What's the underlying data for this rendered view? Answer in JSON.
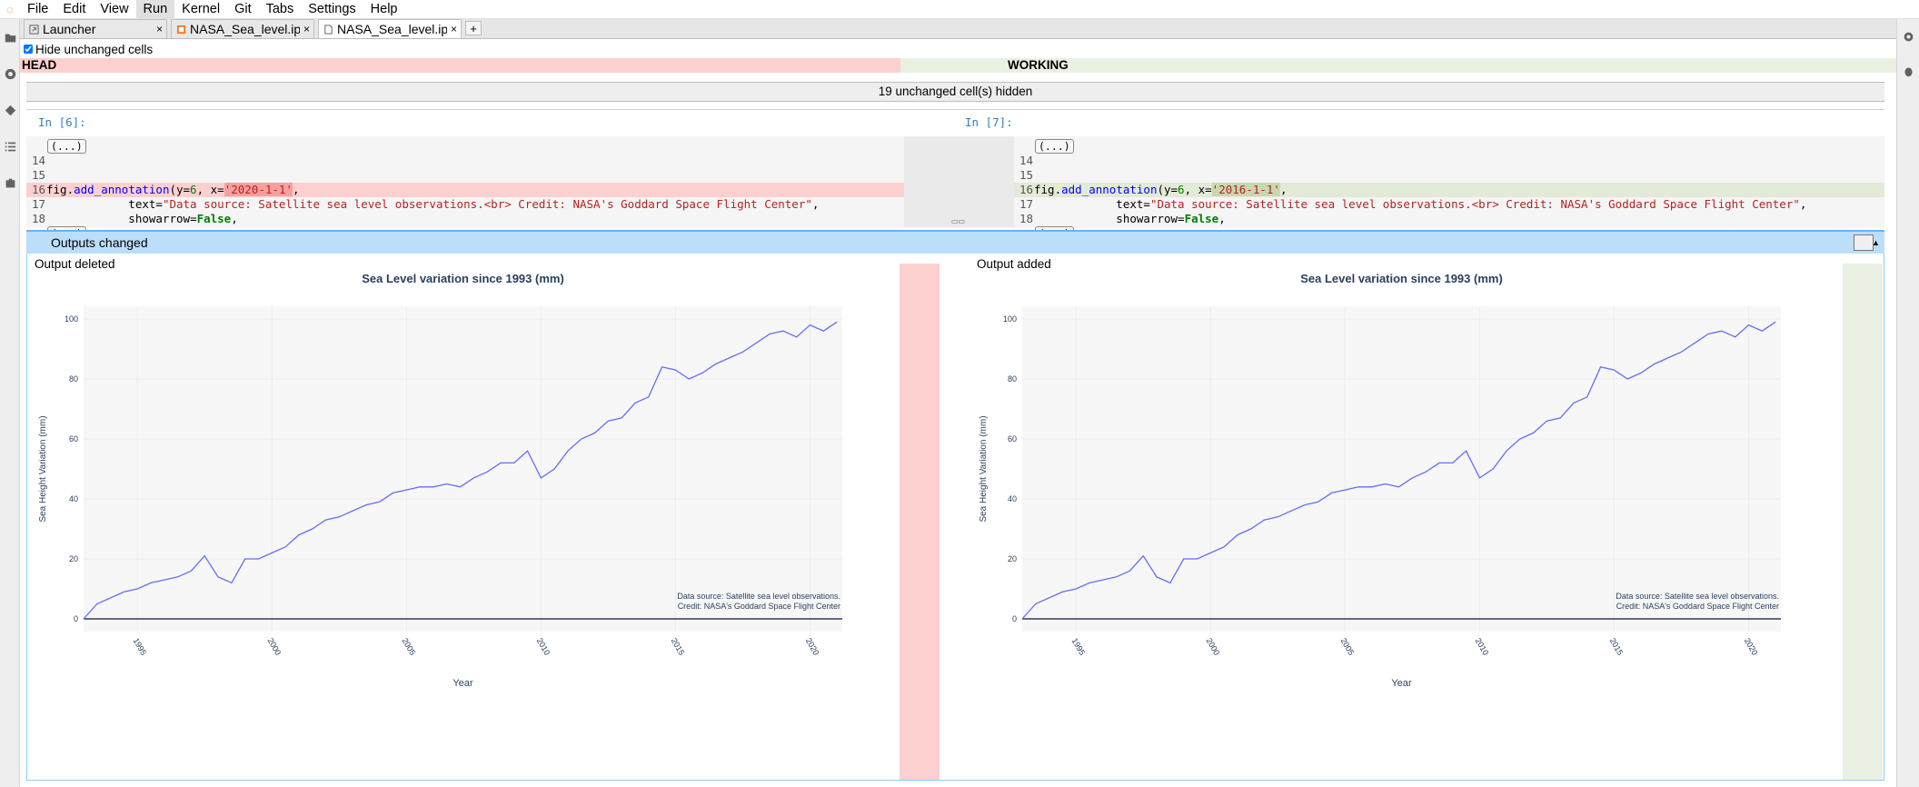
{
  "menubar": {
    "items": [
      "File",
      "Edit",
      "View",
      "Run",
      "Kernel",
      "Git",
      "Tabs",
      "Settings",
      "Help"
    ],
    "active": "Run"
  },
  "tabs": [
    {
      "label": "Launcher",
      "icon": "launcher-icon",
      "close": "×"
    },
    {
      "label": "NASA_Sea_level.ipynb",
      "icon": "notebook-icon",
      "close": "×"
    },
    {
      "label": "NASA_Sea_level.ipynb",
      "icon": "diff-file-icon",
      "close": "×"
    }
  ],
  "add_tab": "+",
  "diff": {
    "hide_unchanged_label": "Hide unchanged cells",
    "hide_unchanged_checked": true,
    "head_label": "HEAD",
    "working_label": "WORKING",
    "hidden_cells_text": "19 unchanged cell(s) hidden",
    "left_prompt": "In [6]:",
    "right_prompt": "In [7]:",
    "ellipsis": "(...)",
    "line_numbers": [
      "14",
      "15",
      "16",
      "17",
      "18"
    ],
    "left_code": {
      "l16_pre": "fig.",
      "l16_fn": "add_annotation",
      "l16_mid": "(y=",
      "l16_num": "6",
      "l16_mid2": ", x=",
      "l16_str": "'2020-1-1'",
      "l16_end": ",",
      "l17_indent": "            text=",
      "l17_str": "\"Data source: Satellite sea level observations.<br> Credit: NASA's Goddard Space Flight Center\"",
      "l17_end": ",",
      "l18_indent": "            showarrow=",
      "l18_kw": "False",
      "l18_end": ","
    },
    "right_code": {
      "l16_pre": "fig.",
      "l16_fn": "add_annotation",
      "l16_mid": "(y=",
      "l16_num": "6",
      "l16_mid2": ", x=",
      "l16_str": "'2016-1-1'",
      "l16_end": ",",
      "l17_indent": "            text=",
      "l17_str": "\"Data source: Satellite sea level observations.<br> Credit: NASA's Goddard Space Flight Center\"",
      "l17_end": ",",
      "l18_indent": "            showarrow=",
      "l18_kw": "False",
      "l18_end": ","
    },
    "outputs_changed_label": "Outputs changed",
    "output_deleted_label": "Output deleted",
    "output_added_label": "Output added"
  },
  "colors": {
    "deleted": "#fdd0d0",
    "added": "#eaf0e2",
    "line": "#636efa",
    "plot_bg": "#f7f7f7"
  },
  "chart_data": [
    {
      "type": "line",
      "title": "Sea Level variation since 1993 (mm)",
      "xlabel": "Year",
      "ylabel": "Sea Height Variation (mm)",
      "xticks": [
        "1995",
        "2000",
        "2005",
        "2010",
        "2015",
        "2020"
      ],
      "yticks": [
        0,
        20,
        40,
        60,
        80,
        100
      ],
      "ylim": [
        0,
        100
      ],
      "xlim": [
        1993.0,
        2021.2
      ],
      "annotation": {
        "lines": [
          "Data source: Satellite sea level observations.",
          "Credit: NASA's Goddard Space Flight Center"
        ],
        "x": "2020-1-1",
        "y": 6
      },
      "series": [
        {
          "x": [
            1993.0,
            1993.5,
            1994.0,
            1994.5,
            1995.0,
            1995.5,
            1996.0,
            1996.5,
            1997.0,
            1997.5,
            1998.0,
            1998.5,
            1999.0,
            1999.5,
            2000.0,
            2000.5,
            2001.0,
            2001.5,
            2002.0,
            2002.5,
            2003.0,
            2003.5,
            2004.0,
            2004.5,
            2005.0,
            2005.5,
            2006.0,
            2006.5,
            2007.0,
            2007.5,
            2008.0,
            2008.5,
            2009.0,
            2009.5,
            2010.0,
            2010.5,
            2011.0,
            2011.5,
            2012.0,
            2012.5,
            2013.0,
            2013.5,
            2014.0,
            2014.5,
            2015.0,
            2015.5,
            2016.0,
            2016.5,
            2017.0,
            2017.5,
            2018.0,
            2018.5,
            2019.0,
            2019.5,
            2020.0,
            2020.5,
            2021.0
          ],
          "y": [
            0,
            5,
            7,
            9,
            10,
            12,
            13,
            14,
            16,
            21,
            14,
            12,
            20,
            20,
            22,
            24,
            28,
            30,
            33,
            34,
            36,
            38,
            39,
            42,
            43,
            44,
            44,
            45,
            44,
            47,
            49,
            52,
            52,
            56,
            47,
            50,
            56,
            60,
            62,
            66,
            67,
            72,
            74,
            84,
            83,
            80,
            82,
            85,
            87,
            89,
            92,
            95,
            96,
            94,
            98,
            96,
            99
          ]
        }
      ]
    },
    {
      "type": "line",
      "title": "Sea Level variation since 1993 (mm)",
      "xlabel": "Year",
      "ylabel": "Sea Height Variation (mm)",
      "xticks": [
        "1995",
        "2000",
        "2005",
        "2010",
        "2015",
        "2020"
      ],
      "yticks": [
        0,
        20,
        40,
        60,
        80,
        100
      ],
      "ylim": [
        0,
        100
      ],
      "xlim": [
        1993.0,
        2021.2
      ],
      "annotation": {
        "lines": [
          "Data source: Satellite sea level observations.",
          "Credit: NASA's Goddard Space Flight Center"
        ],
        "x": "2016-1-1",
        "y": 6
      },
      "series": [
        {
          "x": [
            1993.0,
            1993.5,
            1994.0,
            1994.5,
            1995.0,
            1995.5,
            1996.0,
            1996.5,
            1997.0,
            1997.5,
            1998.0,
            1998.5,
            1999.0,
            1999.5,
            2000.0,
            2000.5,
            2001.0,
            2001.5,
            2002.0,
            2002.5,
            2003.0,
            2003.5,
            2004.0,
            2004.5,
            2005.0,
            2005.5,
            2006.0,
            2006.5,
            2007.0,
            2007.5,
            2008.0,
            2008.5,
            2009.0,
            2009.5,
            2010.0,
            2010.5,
            2011.0,
            2011.5,
            2012.0,
            2012.5,
            2013.0,
            2013.5,
            2014.0,
            2014.5,
            2015.0,
            2015.5,
            2016.0,
            2016.5,
            2017.0,
            2017.5,
            2018.0,
            2018.5,
            2019.0,
            2019.5,
            2020.0,
            2020.5,
            2021.0
          ],
          "y": [
            0,
            5,
            7,
            9,
            10,
            12,
            13,
            14,
            16,
            21,
            14,
            12,
            20,
            20,
            22,
            24,
            28,
            30,
            33,
            34,
            36,
            38,
            39,
            42,
            43,
            44,
            44,
            45,
            44,
            47,
            49,
            52,
            52,
            56,
            47,
            50,
            56,
            60,
            62,
            66,
            67,
            72,
            74,
            84,
            83,
            80,
            82,
            85,
            87,
            89,
            92,
            95,
            96,
            94,
            98,
            96,
            99
          ]
        }
      ]
    }
  ]
}
